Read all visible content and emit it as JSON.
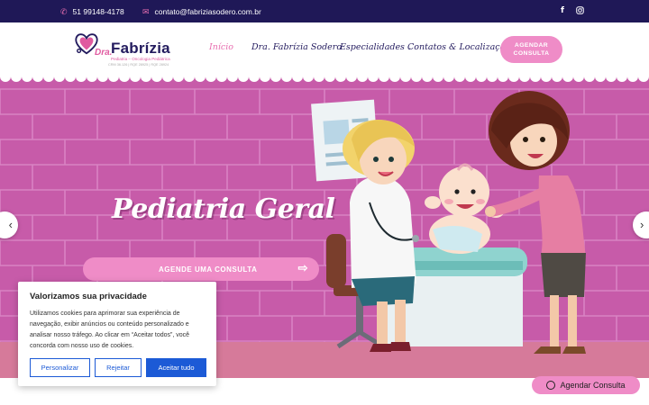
{
  "topbar": {
    "phone_icon": "phone-icon",
    "phone": "51 99148-4178",
    "email_icon": "envelope-icon",
    "email": "contato@fabriziasodero.com.br",
    "social": [
      "facebook-icon",
      "instagram-icon"
    ]
  },
  "logo": {
    "prefix": "Dra.",
    "name": "Fabrízia",
    "subtitle": "Pediatria – Oncologia Pediátrica",
    "registry": "CRM 36.126 | RQE 28925 | RQE 28924"
  },
  "nav": {
    "items": [
      {
        "label": "Início",
        "active": true
      },
      {
        "label": "Dra. Fabrízia Sodero",
        "active": false
      },
      {
        "label": "Especialidades",
        "active": false,
        "dropdown": true
      },
      {
        "label": "Contatos & Localização",
        "active": false
      }
    ],
    "cta": "AGENDAR CONSULTA"
  },
  "hero": {
    "title": "Pediatria Geral",
    "button": "AGENDE UMA CONSULTA",
    "prev_icon": "chevron-left-icon",
    "next_icon": "chevron-right-icon"
  },
  "cookie": {
    "title": "Valorizamos sua privacidade",
    "text": "Utilizamos cookies para aprimorar sua experiência de navegação, exibir anúncios ou conteúdo personalizado e analisar nosso tráfego. Ao clicar em “Aceitar todos”, você concorda com nosso uso de cookies.",
    "customize": "Personalizar",
    "reject": "Rejeitar",
    "accept": "Aceitar tudo"
  },
  "whatsapp": {
    "label": "Agendar Consulta",
    "icon": "whatsapp-icon"
  },
  "colors": {
    "topbar": "#1f1857",
    "brand_pink": "#ef8cc7",
    "navy": "#231b5e",
    "hero_wall": "#c75ba9",
    "cookie_blue": "#1c5ad6"
  }
}
